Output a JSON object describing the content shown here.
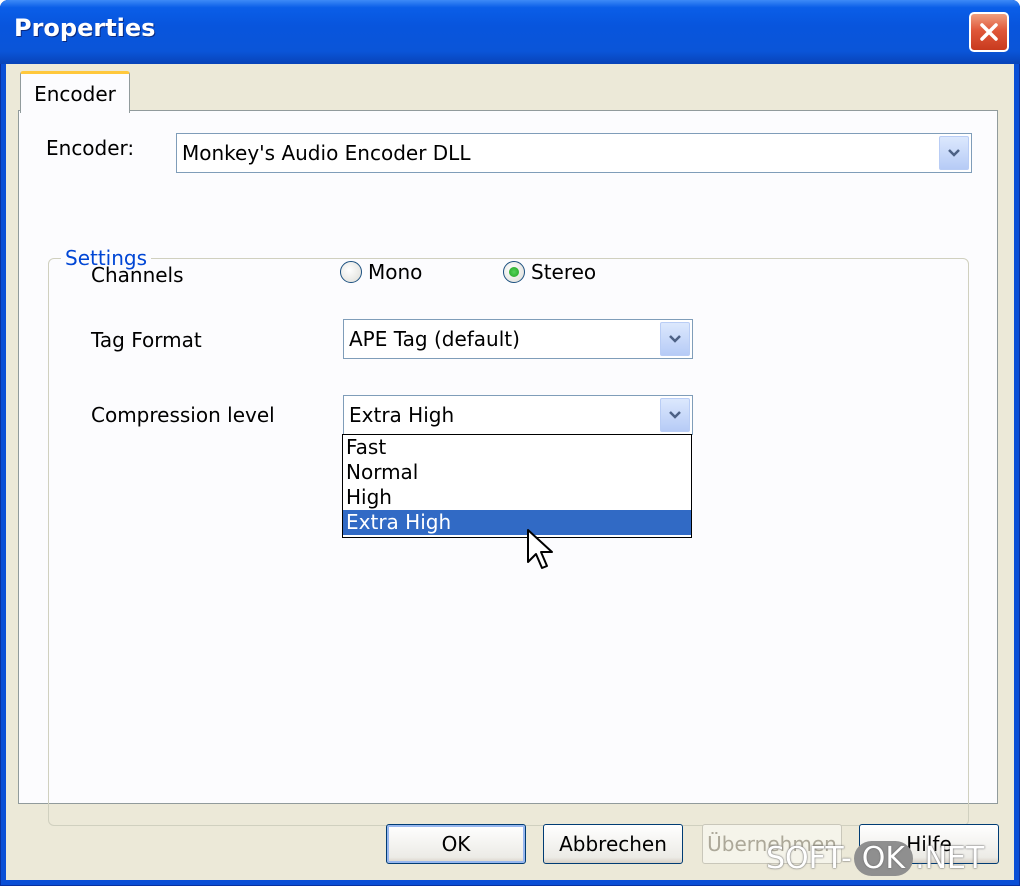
{
  "window": {
    "title": "Properties"
  },
  "tabs": [
    {
      "label": "Encoder",
      "active": true
    }
  ],
  "encoder": {
    "label": "Encoder:",
    "value": "Monkey's Audio Encoder DLL"
  },
  "settings": {
    "title": "Settings",
    "channels": {
      "label": "Channels",
      "options": [
        {
          "label": "Mono",
          "checked": false
        },
        {
          "label": "Stereo",
          "checked": true
        }
      ]
    },
    "tag_format": {
      "label": "Tag Format",
      "value": "APE Tag (default)"
    },
    "compression": {
      "label": "Compression level",
      "value": "Extra High",
      "options": [
        "Fast",
        "Normal",
        "High",
        "Extra High"
      ],
      "selected_option": "Extra High"
    }
  },
  "buttons": {
    "ok": "OK",
    "cancel": "Abbrechen",
    "apply": "Übernehmen",
    "help": "Hilfe"
  },
  "watermark": {
    "part1": "SOFT-",
    "part2": "OK",
    "part3": ".NET"
  },
  "colors": {
    "titlebar": "#0a55d8",
    "client": "#ece9d8",
    "group_title": "#0046d5",
    "selection": "#316ac5",
    "close_button": "#e0583a"
  }
}
